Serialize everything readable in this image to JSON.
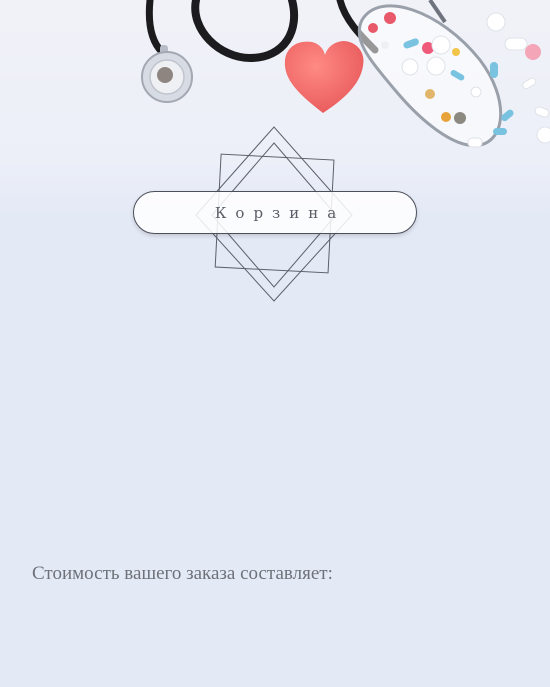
{
  "page": {
    "title": "Корзина",
    "order_cost_label": "Стоимость вашего заказа составляет:"
  },
  "hero": {
    "image": "medical-banner",
    "items": [
      "stethoscope-icon",
      "heart-icon",
      "pills-icon"
    ]
  },
  "colors": {
    "background": "#e4e9f6",
    "heart": "#f06a6a",
    "text": "#6e7178"
  }
}
